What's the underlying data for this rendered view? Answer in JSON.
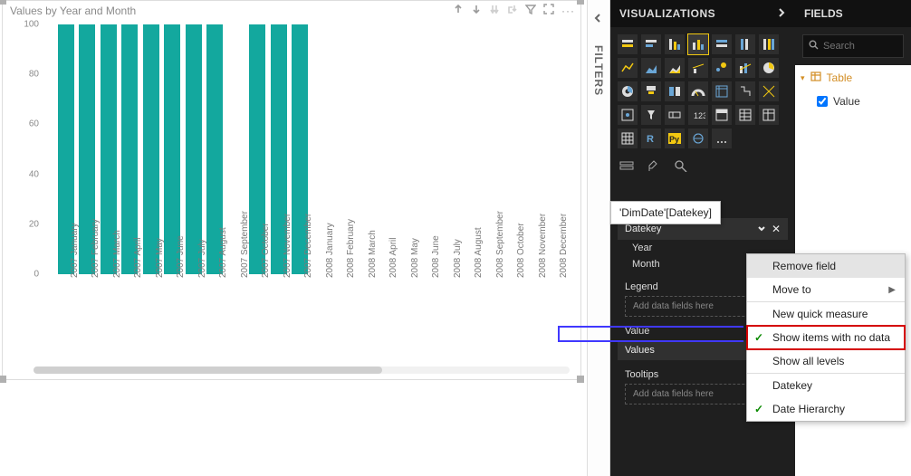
{
  "chart": {
    "title": "Values by Year and Month",
    "y_ticks": [
      0,
      20,
      40,
      60,
      80,
      100
    ],
    "header_icons": [
      "drill-up",
      "drill-down",
      "expand-all",
      "pivot",
      "filter",
      "focus",
      "more"
    ]
  },
  "chart_data": {
    "type": "bar",
    "title": "Values by Year and Month",
    "xlabel": "",
    "ylabel": "",
    "ylim": [
      0,
      100
    ],
    "categories": [
      "2007 January",
      "2007 February",
      "2007 March",
      "2007 April",
      "2007 May",
      "2007 June",
      "2007 July",
      "2007 August",
      "2007 September",
      "2007 October",
      "2007 November",
      "2007 December",
      "2008 January",
      "2008 February",
      "2008 March",
      "2008 April",
      "2008 May",
      "2008 June",
      "2008 July",
      "2008 August",
      "2008 September",
      "2008 October",
      "2008 November",
      "2008 December"
    ],
    "values": [
      100,
      100,
      100,
      100,
      100,
      100,
      100,
      100,
      0,
      100,
      100,
      100,
      0,
      0,
      0,
      0,
      0,
      0,
      0,
      0,
      0,
      0,
      0,
      0
    ]
  },
  "filters": {
    "label": "FILTERS"
  },
  "viz": {
    "title": "VISUALIZATIONS",
    "tooltip": "'DimDate'[Datekey]",
    "wells": {
      "axis_field": "Datekey",
      "axis_sub1": "Year",
      "axis_sub2": "Month",
      "legend_title": "Legend",
      "legend_placeholder": "Add data fields here",
      "value_title": "Value",
      "values_title": "Values",
      "tooltips_title": "Tooltips",
      "tooltips_placeholder": "Add data fields here"
    }
  },
  "fields": {
    "title": "FIELDS",
    "search_placeholder": "Search",
    "table": "Table",
    "items": [
      {
        "label": "Value",
        "checked": true
      }
    ]
  },
  "context_menu": {
    "items": [
      {
        "label": "Remove field",
        "highlight": true
      },
      {
        "label": "Move to",
        "submenu": true
      },
      {
        "label": "New quick measure",
        "divider_before": true
      },
      {
        "label": "Show items with no data",
        "checked": true,
        "red": true
      },
      {
        "label": "Show all levels"
      },
      {
        "label": "Datekey",
        "divider_before": true
      },
      {
        "label": "Date Hierarchy",
        "checked": true
      }
    ]
  }
}
